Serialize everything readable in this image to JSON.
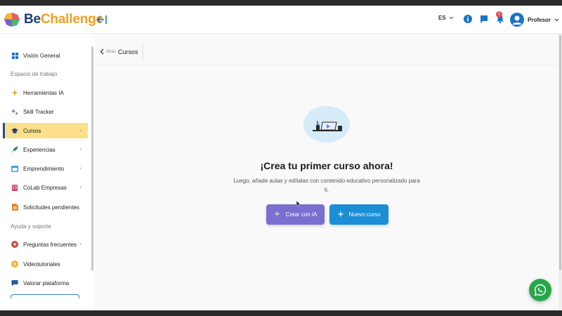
{
  "brand": {
    "part1": "Be",
    "part2": "Challenge"
  },
  "topbar": {
    "language": "ES",
    "notifications_count": "1",
    "user_name": "Profesor"
  },
  "sidebar": {
    "items": [
      {
        "label": "Visión General",
        "icon": "grid-icon"
      },
      {
        "label": "Herramientas IA",
        "icon": "sparkle-icon"
      },
      {
        "label": "Skill Tracker",
        "icon": "stars-icon"
      },
      {
        "label": "Cursos",
        "icon": "graduation-cap-icon",
        "active": true
      },
      {
        "label": "Experiencias",
        "icon": "rocket-icon"
      },
      {
        "label": "Emprendimiento",
        "icon": "window-icon"
      },
      {
        "label": "CoLab Empresas",
        "icon": "building-icon"
      },
      {
        "label": "Solicitudes pendientes",
        "icon": "document-icon"
      },
      {
        "label": "Preguntas frecuentes",
        "icon": "question-icon"
      },
      {
        "label": "Videotutoriales",
        "icon": "play-circle-icon"
      },
      {
        "label": "Valorar plataforma",
        "icon": "chat-icon"
      }
    ],
    "sections": {
      "workspace": "Espacio de trabajo",
      "help": "Ayuda y soporte"
    }
  },
  "breadcrumb": {
    "back": "Atrás",
    "title": "Cursos"
  },
  "empty_state": {
    "title": "¡Crea tu primer curso ahora!",
    "subtitle": "Luego, añade aulas y edítalas con contenido educativo personalizado para ti.",
    "create_ai_label": "Crear con IA",
    "new_course_label": "Nuevo curso"
  },
  "colors": {
    "accent": "#1a73c8",
    "active_bg": "#fbdf8a",
    "ai_button": "#7a6fd1",
    "new_button": "#1a8fd6",
    "whatsapp": "#27a74a"
  }
}
